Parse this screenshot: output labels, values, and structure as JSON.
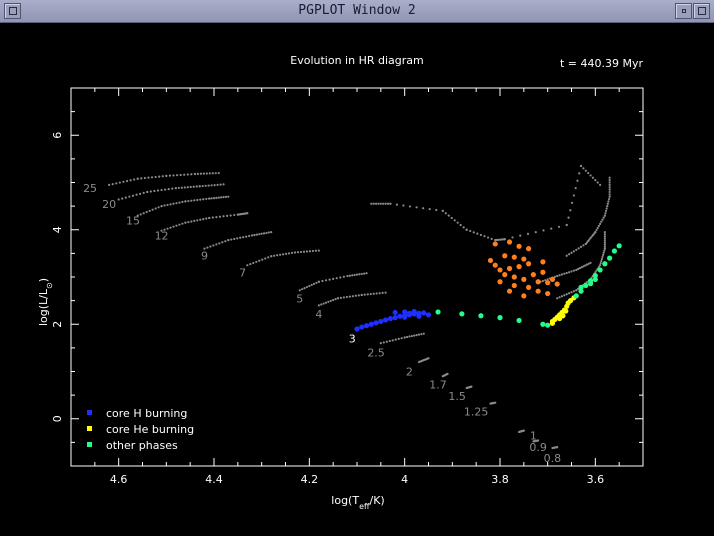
{
  "window": {
    "title": "PGPLOT Window 2"
  },
  "chart_data": {
    "type": "scatter",
    "title": "Evolution in HR diagram",
    "time_label": "t = 440.39 Myr",
    "xlabel": "log(T",
    "xlabel_sub": "eff",
    "xlabel_tail": "/K)",
    "ylabel": "log(L/L",
    "ylabel_sub": "⊙",
    "ylabel_tail": ")",
    "xlim": [
      4.7,
      3.5
    ],
    "ylim": [
      -1.0,
      7.0
    ],
    "x_ticks": [
      "4.6",
      "4.4",
      "4.2",
      "4",
      "3.8",
      "3.6"
    ],
    "y_ticks": [
      "0",
      "2",
      "4",
      "6"
    ],
    "colors": {
      "background": "#000000",
      "axes": "#ffffff",
      "track": "#8a8a8a",
      "core_h": "#1f2fff",
      "core_he": "#ffff00",
      "other": "#22ff88",
      "giants": "#ff7f1e"
    },
    "legend": [
      {
        "label": "core H burning",
        "color": "#1f2fff"
      },
      {
        "label": "core He burning",
        "color": "#ffff00"
      },
      {
        "label": "other phases",
        "color": "#22ff88"
      }
    ],
    "mass_labels": [
      {
        "text": "25",
        "x": 4.66,
        "y": 4.88
      },
      {
        "text": "20",
        "x": 4.62,
        "y": 4.55
      },
      {
        "text": "15",
        "x": 4.57,
        "y": 4.2
      },
      {
        "text": "12",
        "x": 4.51,
        "y": 3.88
      },
      {
        "text": "9",
        "x": 4.42,
        "y": 3.45
      },
      {
        "text": "7",
        "x": 4.34,
        "y": 3.1
      },
      {
        "text": "5",
        "x": 4.22,
        "y": 2.55
      },
      {
        "text": "4",
        "x": 4.18,
        "y": 2.22
      },
      {
        "text": "3",
        "x": 4.11,
        "y": 1.7
      },
      {
        "text": "2.5",
        "x": 4.06,
        "y": 1.4
      },
      {
        "text": "2",
        "x": 3.99,
        "y": 1.0
      },
      {
        "text": "1.7",
        "x": 3.93,
        "y": 0.72
      },
      {
        "text": "1.5",
        "x": 3.89,
        "y": 0.48
      },
      {
        "text": "1.25",
        "x": 3.85,
        "y": 0.15
      },
      {
        "text": "1",
        "x": 3.73,
        "y": -0.35
      },
      {
        "text": "0.9",
        "x": 3.72,
        "y": -0.6
      },
      {
        "text": "0.8",
        "x": 3.69,
        "y": -0.83
      }
    ],
    "tracks": [
      {
        "mass": "25",
        "points": [
          [
            4.62,
            4.95
          ],
          [
            4.56,
            5.08
          ],
          [
            4.5,
            5.14
          ],
          [
            4.44,
            5.18
          ],
          [
            4.39,
            5.2
          ]
        ]
      },
      {
        "mass": "20",
        "points": [
          [
            4.6,
            4.64
          ],
          [
            4.54,
            4.8
          ],
          [
            4.48,
            4.88
          ],
          [
            4.43,
            4.92
          ],
          [
            4.38,
            4.96
          ]
        ]
      },
      {
        "mass": "15",
        "points": [
          [
            4.56,
            4.3
          ],
          [
            4.51,
            4.5
          ],
          [
            4.46,
            4.6
          ],
          [
            4.41,
            4.66
          ],
          [
            4.37,
            4.7
          ]
        ]
      },
      {
        "mass": "12",
        "points": [
          [
            4.51,
            3.98
          ],
          [
            4.46,
            4.15
          ],
          [
            4.41,
            4.25
          ],
          [
            4.35,
            4.32
          ],
          [
            4.33,
            4.35
          ]
        ]
      },
      {
        "mass": "9",
        "points": [
          [
            4.42,
            3.6
          ],
          [
            4.37,
            3.78
          ],
          [
            4.32,
            3.88
          ],
          [
            4.28,
            3.95
          ]
        ]
      },
      {
        "mass": "7",
        "points": [
          [
            4.33,
            3.25
          ],
          [
            4.28,
            3.44
          ],
          [
            4.23,
            3.52
          ],
          [
            4.18,
            3.56
          ]
        ]
      },
      {
        "mass": "5",
        "points": [
          [
            4.22,
            2.72
          ],
          [
            4.18,
            2.9
          ],
          [
            4.12,
            3.02
          ],
          [
            4.08,
            3.08
          ]
        ]
      },
      {
        "mass": "4",
        "points": [
          [
            4.18,
            2.4
          ],
          [
            4.14,
            2.55
          ],
          [
            4.09,
            2.62
          ],
          [
            4.04,
            2.67
          ]
        ]
      },
      {
        "mass": "2.5",
        "points": [
          [
            4.05,
            1.6
          ],
          [
            4.0,
            1.72
          ],
          [
            3.96,
            1.8
          ]
        ]
      },
      {
        "mass": "2",
        "points": [
          [
            3.97,
            1.2
          ],
          [
            3.95,
            1.28
          ]
        ]
      },
      {
        "mass": "1.7",
        "points": [
          [
            3.92,
            0.9
          ],
          [
            3.91,
            0.95
          ]
        ]
      },
      {
        "mass": "1.5",
        "points": [
          [
            3.87,
            0.65
          ],
          [
            3.86,
            0.68
          ]
        ]
      },
      {
        "mass": "1.25",
        "points": [
          [
            3.82,
            0.32
          ],
          [
            3.81,
            0.34
          ]
        ]
      },
      {
        "mass": "1",
        "points": [
          [
            3.76,
            -0.28
          ],
          [
            3.75,
            -0.25
          ]
        ]
      },
      {
        "mass": "0.9",
        "points": [
          [
            3.73,
            -0.48
          ],
          [
            3.72,
            -0.46
          ]
        ]
      },
      {
        "mass": "0.8",
        "points": [
          [
            3.69,
            -0.62
          ],
          [
            3.68,
            -0.6
          ]
        ]
      },
      {
        "mass": "3-giant",
        "points": [
          [
            3.72,
            2.88
          ],
          [
            3.68,
            3.02
          ],
          [
            3.64,
            3.15
          ],
          [
            3.61,
            3.3
          ]
        ]
      },
      {
        "mass": "3-giant-b",
        "points": [
          [
            3.68,
            2.55
          ],
          [
            3.64,
            2.72
          ],
          [
            3.61,
            2.95
          ],
          [
            3.59,
            3.25
          ],
          [
            3.58,
            3.6
          ],
          [
            3.58,
            3.95
          ]
        ]
      },
      {
        "mass": "3-giant-c",
        "points": [
          [
            3.66,
            3.45
          ],
          [
            3.62,
            3.7
          ],
          [
            3.6,
            3.95
          ],
          [
            3.58,
            4.3
          ],
          [
            3.57,
            4.7
          ],
          [
            3.57,
            5.1
          ]
        ]
      },
      {
        "mass": "scatter-grey",
        "points": [
          [
            4.07,
            4.55
          ],
          [
            4.03,
            4.55
          ],
          [
            3.92,
            4.4
          ],
          [
            3.87,
            4.0
          ],
          [
            3.81,
            3.78
          ],
          [
            3.79,
            3.8
          ],
          [
            3.66,
            4.1
          ],
          [
            3.63,
            5.35
          ],
          [
            3.59,
            4.95
          ]
        ]
      }
    ],
    "series": [
      {
        "name": "core H burning",
        "color": "#1f2fff",
        "points": [
          [
            4.1,
            1.9
          ],
          [
            4.09,
            1.94
          ],
          [
            4.08,
            1.97
          ],
          [
            4.07,
            2.0
          ],
          [
            4.06,
            2.03
          ],
          [
            4.05,
            2.06
          ],
          [
            4.04,
            2.09
          ],
          [
            4.03,
            2.12
          ],
          [
            4.02,
            2.14
          ],
          [
            4.01,
            2.17
          ],
          [
            4.0,
            2.18
          ],
          [
            3.99,
            2.2
          ],
          [
            3.98,
            2.22
          ],
          [
            3.97,
            2.23
          ],
          [
            3.96,
            2.24
          ],
          [
            4.0,
            2.26
          ],
          [
            4.02,
            2.25
          ],
          [
            3.98,
            2.27
          ],
          [
            3.95,
            2.2
          ],
          [
            3.97,
            2.17
          ],
          [
            4.0,
            2.15
          ],
          [
            3.99,
            2.23
          ]
        ]
      },
      {
        "name": "core He burning",
        "color": "#ffff00",
        "points": [
          [
            3.69,
            2.06
          ],
          [
            3.685,
            2.1
          ],
          [
            3.68,
            2.15
          ],
          [
            3.675,
            2.2
          ],
          [
            3.67,
            2.25
          ],
          [
            3.665,
            2.3
          ],
          [
            3.66,
            2.38
          ],
          [
            3.657,
            2.45
          ],
          [
            3.652,
            2.5
          ],
          [
            3.645,
            2.56
          ],
          [
            3.69,
            2.02
          ],
          [
            3.675,
            2.12
          ],
          [
            3.668,
            2.18
          ],
          [
            3.662,
            2.28
          ]
        ]
      },
      {
        "name": "other phases",
        "color": "#22ff88",
        "points": [
          [
            3.93,
            2.26
          ],
          [
            3.88,
            2.22
          ],
          [
            3.84,
            2.18
          ],
          [
            3.8,
            2.14
          ],
          [
            3.76,
            2.08
          ],
          [
            3.71,
            2.0
          ],
          [
            3.7,
            1.98
          ],
          [
            3.64,
            2.6
          ],
          [
            3.63,
            2.7
          ],
          [
            3.62,
            2.82
          ],
          [
            3.61,
            2.92
          ],
          [
            3.6,
            3.03
          ],
          [
            3.59,
            3.15
          ],
          [
            3.58,
            3.28
          ],
          [
            3.57,
            3.4
          ],
          [
            3.56,
            3.55
          ],
          [
            3.55,
            3.66
          ],
          [
            3.6,
            2.95
          ],
          [
            3.61,
            2.86
          ],
          [
            3.63,
            2.78
          ]
        ]
      },
      {
        "name": "",
        "color": "#ff7f1e",
        "points": [
          [
            3.81,
            3.7
          ],
          [
            3.78,
            3.74
          ],
          [
            3.76,
            3.65
          ],
          [
            3.74,
            3.6
          ],
          [
            3.79,
            3.45
          ],
          [
            3.77,
            3.42
          ],
          [
            3.75,
            3.38
          ],
          [
            3.81,
            3.25
          ],
          [
            3.8,
            3.15
          ],
          [
            3.78,
            3.18
          ],
          [
            3.76,
            3.22
          ],
          [
            3.74,
            3.28
          ],
          [
            3.71,
            3.32
          ],
          [
            3.79,
            3.05
          ],
          [
            3.77,
            3.0
          ],
          [
            3.75,
            2.95
          ],
          [
            3.72,
            2.9
          ],
          [
            3.7,
            2.88
          ],
          [
            3.68,
            2.85
          ],
          [
            3.8,
            2.9
          ],
          [
            3.77,
            2.82
          ],
          [
            3.74,
            2.78
          ],
          [
            3.72,
            2.7
          ],
          [
            3.7,
            2.65
          ],
          [
            3.75,
            2.6
          ],
          [
            3.69,
            2.95
          ],
          [
            3.73,
            3.05
          ],
          [
            3.82,
            3.35
          ],
          [
            3.78,
            2.7
          ],
          [
            3.71,
            3.1
          ]
        ]
      }
    ]
  }
}
